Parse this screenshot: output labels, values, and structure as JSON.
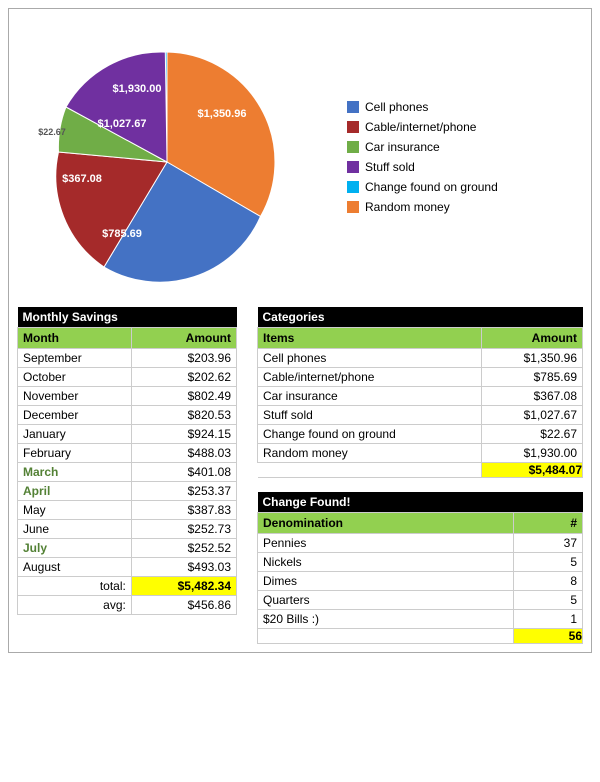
{
  "chart": {
    "segments": [
      {
        "label": "Cell phones",
        "value": "$1,350.96",
        "color": "#4472c4",
        "percent": 24.6,
        "startAngle": 0
      },
      {
        "label": "Cable/internet/phone",
        "value": "$785.69",
        "color": "#a52a2a",
        "percent": 14.3
      },
      {
        "label": "Car insurance",
        "value": "$367.08",
        "color": "#70ad47",
        "percent": 6.7
      },
      {
        "label": "Stuff sold",
        "value": "$1,027.67",
        "color": "#7030a0",
        "percent": 18.7
      },
      {
        "label": "Change found on ground",
        "value": "$22.67",
        "color": "#00b0f0",
        "percent": 0.4
      },
      {
        "label": "Random money",
        "value": "$1,930.00",
        "color": "#ed7d31",
        "percent": 35.2
      }
    ],
    "legend": [
      {
        "label": "Cell phones",
        "color": "#4472c4"
      },
      {
        "label": "Cable/internet/phone",
        "color": "#a52a2a"
      },
      {
        "label": "Car insurance",
        "color": "#70ad47"
      },
      {
        "label": "Stuff sold",
        "color": "#7030a0"
      },
      {
        "label": "Change found on ground",
        "color": "#00b0f0"
      },
      {
        "label": "Random money",
        "color": "#ed7d31"
      }
    ]
  },
  "monthly_savings": {
    "title": "Monthly Savings",
    "col_month": "Month",
    "col_amount": "Amount",
    "rows": [
      {
        "month": "September",
        "amount": "$203.96",
        "green": false
      },
      {
        "month": "October",
        "amount": "$202.62",
        "green": false
      },
      {
        "month": "November",
        "amount": "$802.49",
        "green": false
      },
      {
        "month": "December",
        "amount": "$820.53",
        "green": false
      },
      {
        "month": "January",
        "amount": "$924.15",
        "green": false
      },
      {
        "month": "February",
        "amount": "$488.03",
        "green": false
      },
      {
        "month": "March",
        "amount": "$401.08",
        "green": true
      },
      {
        "month": "April",
        "amount": "$253.37",
        "green": true
      },
      {
        "month": "May",
        "amount": "$387.83",
        "green": false
      },
      {
        "month": "June",
        "amount": "$252.73",
        "green": false
      },
      {
        "month": "July",
        "amount": "$252.52",
        "green": true
      },
      {
        "month": "August",
        "amount": "$493.03",
        "green": false
      }
    ],
    "total_label": "total:",
    "total_value": "$5,482.34",
    "avg_label": "avg:",
    "avg_value": "$456.86"
  },
  "categories": {
    "title": "Categories",
    "col_items": "Items",
    "col_amount": "Amount",
    "rows": [
      {
        "item": "Cell phones",
        "amount": "$1,350.96"
      },
      {
        "item": "Cable/internet/phone",
        "amount": "$785.69"
      },
      {
        "item": "Car insurance",
        "amount": "$367.08"
      },
      {
        "item": "Stuff sold",
        "amount": "$1,027.67"
      },
      {
        "item": "Change found on ground",
        "amount": "$22.67"
      },
      {
        "item": "Random money",
        "amount": "$1,930.00"
      }
    ],
    "total_value": "$5,484.07"
  },
  "change_found": {
    "title": "Change Found!",
    "col_denomination": "Denomination",
    "col_number": "#",
    "rows": [
      {
        "denomination": "Pennies",
        "number": "37"
      },
      {
        "denomination": "Nickels",
        "number": "5"
      },
      {
        "denomination": "Dimes",
        "number": "8"
      },
      {
        "denomination": "Quarters",
        "number": "5"
      },
      {
        "denomination": "$20 Bills :)",
        "number": "1"
      }
    ],
    "total_value": "56"
  }
}
